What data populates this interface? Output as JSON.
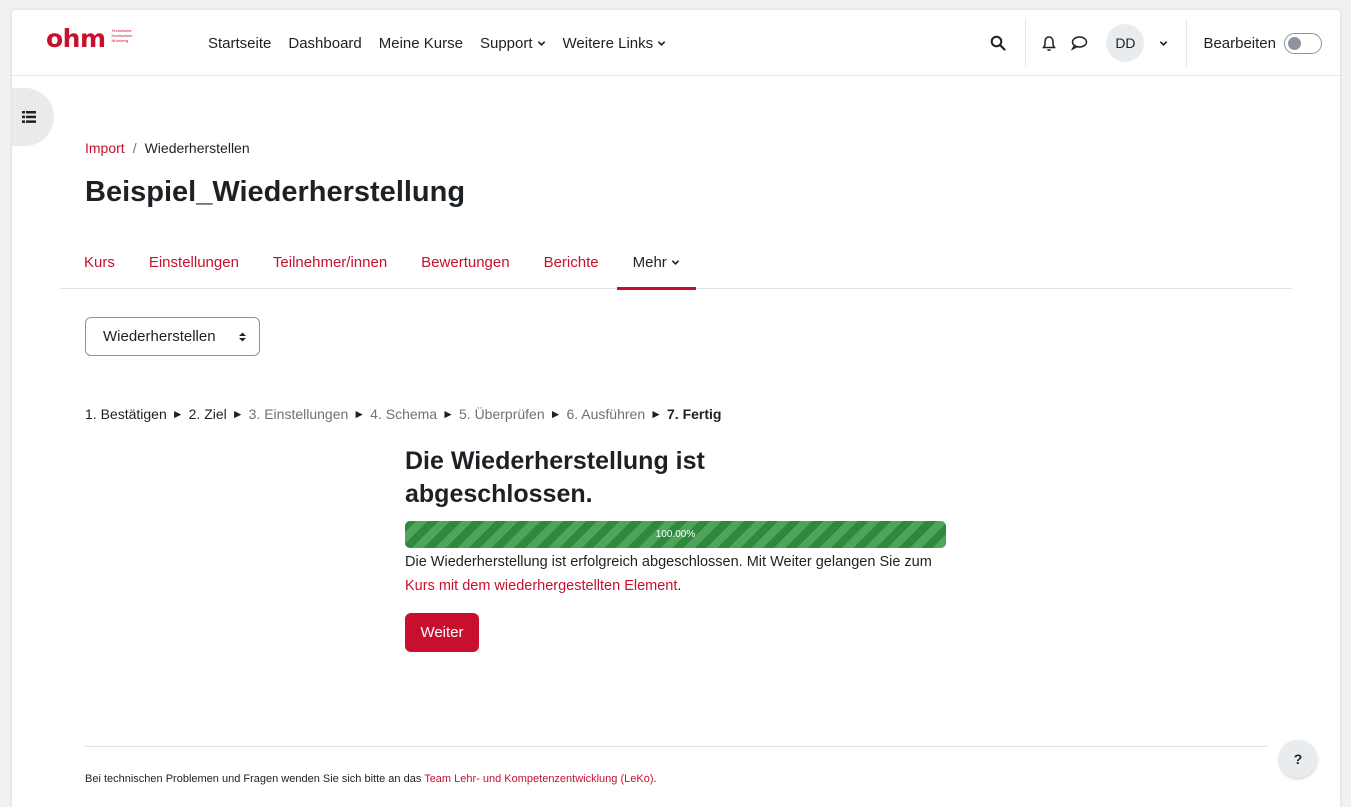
{
  "brand": {
    "logo_text": "ohm",
    "logo_sub": [
      "Technische",
      "Hochschule",
      "Nürnberg"
    ],
    "accent_color": "#c8102e"
  },
  "primary_nav": {
    "items": [
      {
        "label": "Startseite",
        "dropdown": false
      },
      {
        "label": "Dashboard",
        "dropdown": false
      },
      {
        "label": "Meine Kurse",
        "dropdown": false
      },
      {
        "label": "Support",
        "dropdown": true
      },
      {
        "label": "Weitere Links",
        "dropdown": true
      }
    ]
  },
  "user_menu": {
    "icons": [
      "search-icon",
      "bell-icon",
      "chat-bubble-icon"
    ],
    "initials": "DD",
    "edit_label": "Bearbeiten",
    "edit_mode_on": false
  },
  "breadcrumb": {
    "link": "Import",
    "separator": "/",
    "current": "Wiederherstellen"
  },
  "page_title": "Beispiel_Wiederherstellung",
  "secondary_nav": {
    "items": [
      {
        "label": "Kurs",
        "active": false
      },
      {
        "label": "Einstellungen",
        "active": false
      },
      {
        "label": "Teilnehmer/innen",
        "active": false
      },
      {
        "label": "Bewertungen",
        "active": false
      },
      {
        "label": "Berichte",
        "active": false
      },
      {
        "label": "Mehr",
        "active": true,
        "dropdown": true
      }
    ]
  },
  "action_select": {
    "selected": "Wiederherstellen",
    "arrow": "⬍"
  },
  "steps": [
    {
      "label": "1. Bestätigen",
      "state": "done"
    },
    {
      "label": "2. Ziel",
      "state": "done"
    },
    {
      "label": "3. Einstellungen",
      "state": "skipped"
    },
    {
      "label": "4. Schema",
      "state": "skipped"
    },
    {
      "label": "5. Überprüfen",
      "state": "skipped"
    },
    {
      "label": "6. Ausführen",
      "state": "skipped"
    },
    {
      "label": "7. Fertig",
      "state": "current"
    }
  ],
  "step_arrow": "►",
  "result": {
    "title": "Die Wiederherstellung ist abgeschlossen.",
    "progress_label": "100.00%",
    "progress_value": 100,
    "text_before": "Die Wiederherstellung ist erfolgreich abgeschlossen. Mit Weiter gelangen Sie zum ",
    "link_text": "Kurs mit dem wiederhergestellten Element",
    "text_after": ".",
    "continue_label": "Weiter"
  },
  "footer": {
    "text": "Bei technischen Problemen und Fragen wenden Sie sich bitte an das ",
    "link_text": "Team Lehr- und Kompetenzentwicklung (LeKo)",
    "suffix": "."
  },
  "help_label": "?"
}
